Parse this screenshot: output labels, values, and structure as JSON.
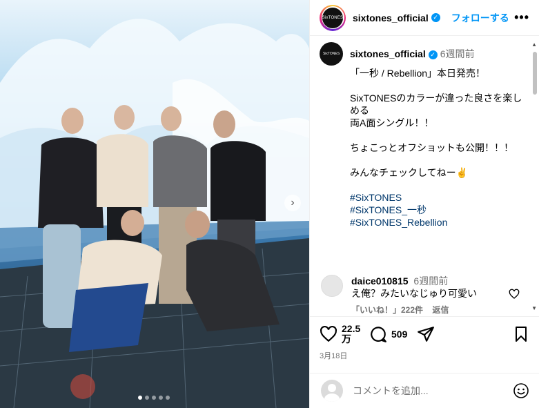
{
  "post": {
    "username": "sixtones_official",
    "follow_label": "フォローする",
    "more_label": "•••",
    "avatar_text": "SixTONES",
    "carousel": {
      "total_slides": 5,
      "current_slide": 1
    }
  },
  "caption": {
    "username": "sixtones_official",
    "time": "6週間前",
    "text": "「一秒 / Rebellion」本日発売！\n\nSixTONESのカラーが違った良さを楽しめる\n両A面シングル！！\n\nちょこっとオフショットも公開！！！\n\nみんなチェックしてねー✌️\n\n",
    "hashtags": [
      "#SixTONES",
      "#SixTONES_一秒",
      "#SixTONES_Rebellion"
    ]
  },
  "comment": {
    "username": "daice010815",
    "time": "6週間前",
    "text": "え俺？みたいなじゅり可愛い",
    "likes": "「いいね！」222件",
    "reply_label": "返信"
  },
  "actions": {
    "likes_line1": "22.5",
    "likes_line2": "万",
    "comments_count": "509",
    "date": "3月18日"
  },
  "add_comment": {
    "placeholder": "コメントを追加..."
  },
  "colors": {
    "accent": "#0095f6",
    "hashtag": "#00376b",
    "muted": "#737373"
  }
}
